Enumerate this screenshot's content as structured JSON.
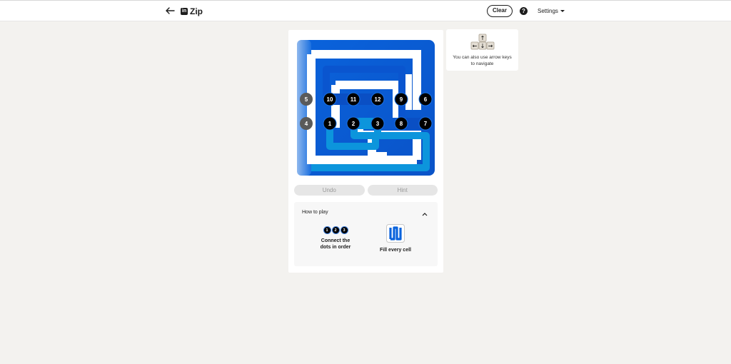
{
  "header": {
    "back_icon": "arrow-left-icon",
    "logo_text": "in",
    "title": "Zip",
    "clear_label": "Clear",
    "help_label": "?",
    "settings_label": "Settings"
  },
  "puzzle": {
    "colors": {
      "path_dark": "#0a5fd6",
      "path_light": "#0c9fe0",
      "wall": "#ffffff",
      "dot": "#000000",
      "dot_inactive": "#5a5a5a"
    },
    "dots": [
      {
        "label": "1",
        "state": "active"
      },
      {
        "label": "2",
        "state": "active"
      },
      {
        "label": "3",
        "state": "active"
      },
      {
        "label": "4",
        "state": "inactive"
      },
      {
        "label": "5",
        "state": "inactive"
      },
      {
        "label": "6",
        "state": "active"
      },
      {
        "label": "7",
        "state": "active"
      },
      {
        "label": "8",
        "state": "active"
      },
      {
        "label": "9",
        "state": "active"
      },
      {
        "label": "10",
        "state": "active"
      },
      {
        "label": "11",
        "state": "active"
      },
      {
        "label": "12",
        "state": "active"
      }
    ]
  },
  "controls": {
    "undo_label": "Undo",
    "hint_label": "Hint"
  },
  "how_to_play": {
    "title": "How to play",
    "steps": [
      {
        "text_line1": "Connect the",
        "text_line2": "dots in order",
        "mini_dots": [
          "1",
          "2",
          "3"
        ]
      },
      {
        "text_line1": "Fill every cell"
      }
    ]
  },
  "tip": {
    "keys": [
      "↑",
      "←",
      "↓",
      "→"
    ],
    "text": "You can also use arrow keys to navigate"
  }
}
